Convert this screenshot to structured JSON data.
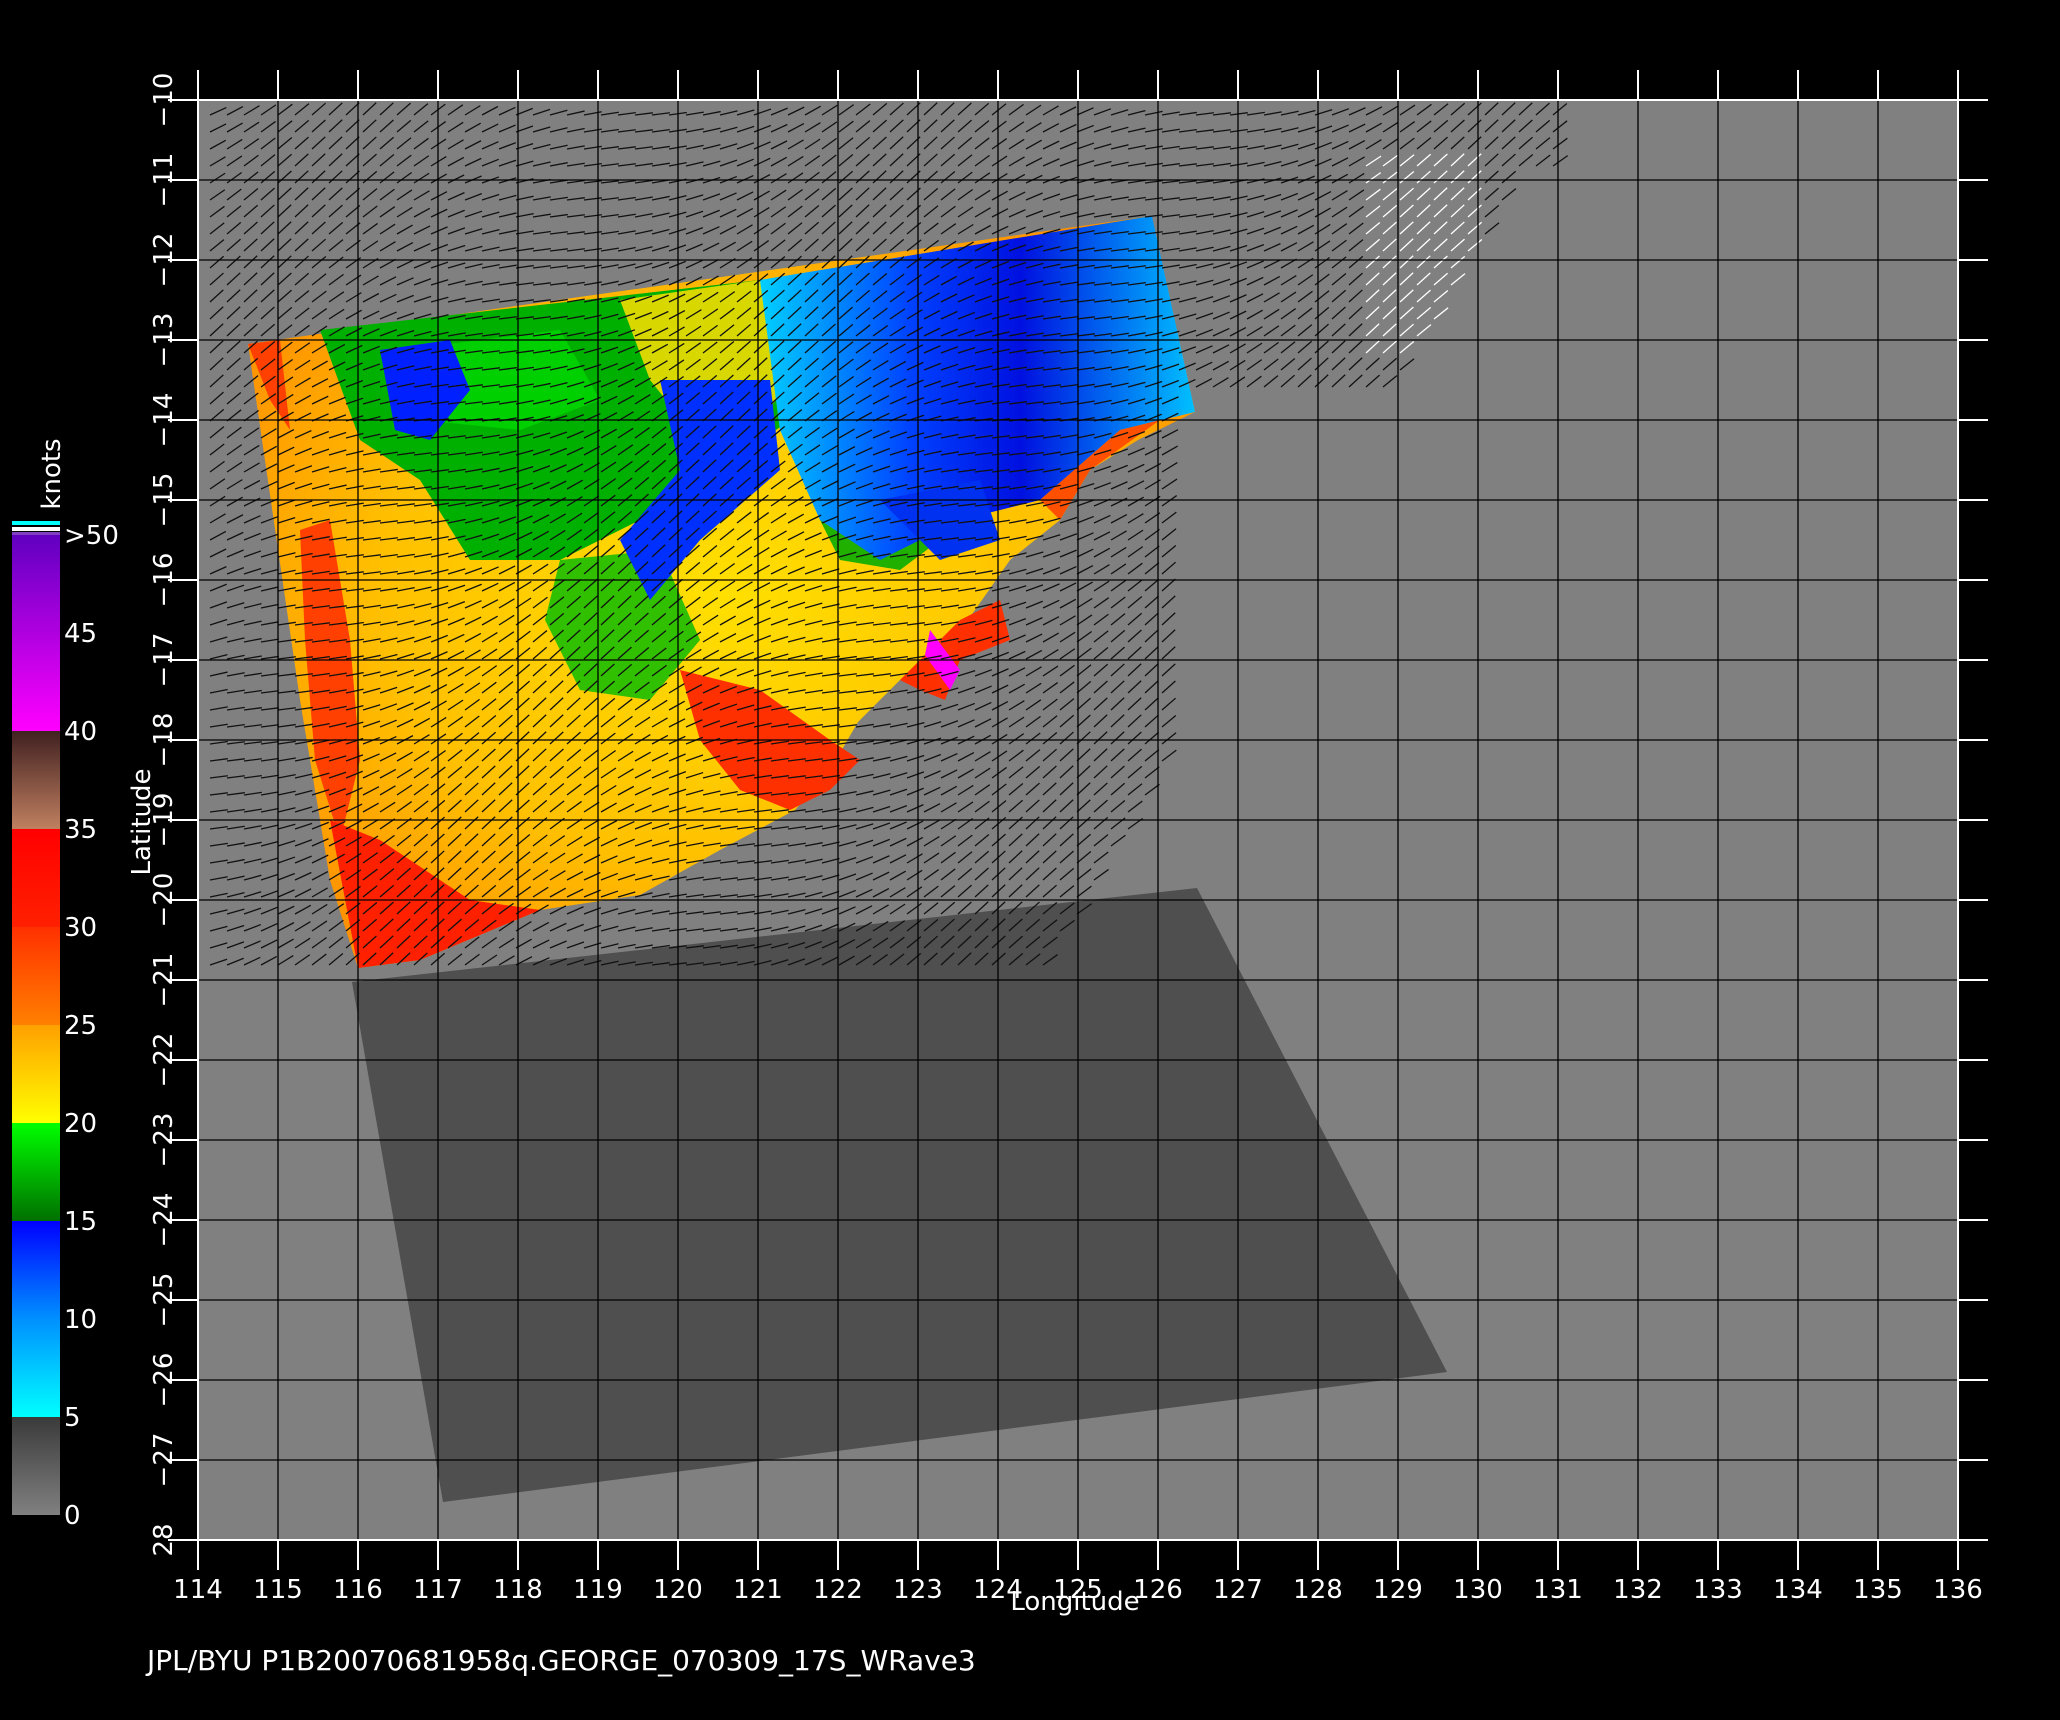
{
  "map": {
    "xlabel": "Longitude",
    "ylabel": "Latitude",
    "lon_range": [
      114,
      136
    ],
    "lat_range": [
      -28,
      -10
    ],
    "lon_ticks": [
      114,
      115,
      116,
      117,
      118,
      119,
      120,
      121,
      122,
      123,
      124,
      125,
      126,
      127,
      128,
      129,
      130,
      131,
      132,
      133,
      134,
      135,
      136
    ],
    "lat_ticks": [
      -10,
      -11,
      -12,
      -13,
      -14,
      -15,
      -16,
      -17,
      -18,
      -19,
      -20,
      -21,
      -22,
      -23,
      -24,
      -25,
      -26,
      -27,
      -28
    ],
    "lat_tick_labels": [
      "−10",
      "−11",
      "−12",
      "−13",
      "−14",
      "−15",
      "−16",
      "−17",
      "−18",
      "−19",
      "−20",
      "−21",
      "−22",
      "−23",
      "−24",
      "−25",
      "−26",
      "−27",
      "28"
    ],
    "background_color": "#808080",
    "land_color": "#4f4f4f",
    "vector_color": "#111111",
    "vector_rain_color": "#ffffff"
  },
  "colorbar": {
    "unit": "knots",
    "tick_labels": [
      "0",
      "5",
      "10",
      "15",
      "20",
      "25",
      "30",
      "35",
      "40",
      "45",
      ">50"
    ],
    "ranges": [
      {
        "from": 0,
        "to": 5,
        "colors": [
          "#808080",
          "#3a3a3a"
        ]
      },
      {
        "from": 5,
        "to": 10,
        "colors": [
          "#00ffff",
          "#0090ff"
        ]
      },
      {
        "from": 10,
        "to": 15,
        "colors": [
          "#0090ff",
          "#0000ff"
        ]
      },
      {
        "from": 15,
        "to": 20,
        "colors": [
          "#007000",
          "#00ff00"
        ]
      },
      {
        "from": 20,
        "to": 25,
        "colors": [
          "#ffff00",
          "#ffa000"
        ]
      },
      {
        "from": 25,
        "to": 30,
        "colors": [
          "#ff8000",
          "#ff3000"
        ]
      },
      {
        "from": 30,
        "to": 35,
        "colors": [
          "#ff2000",
          "#ff0000"
        ]
      },
      {
        "from": 35,
        "to": 40,
        "colors": [
          "#c08060",
          "#402020"
        ]
      },
      {
        "from": 40,
        "to": 50,
        "colors": [
          "#ff00ff",
          "#6000c0"
        ]
      }
    ]
  },
  "footer": {
    "text": "JPL/BYU  P1B20070681958q.GEORGE_070309_17S_WRave3"
  }
}
